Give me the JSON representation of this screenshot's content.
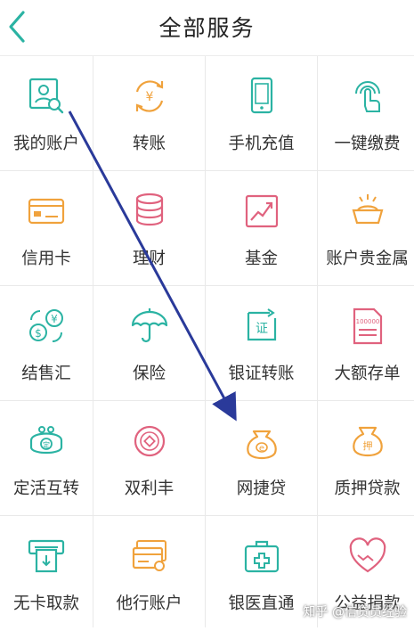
{
  "header": {
    "title": "全部服务"
  },
  "services": [
    {
      "label": "我的账户",
      "icon": "account-icon"
    },
    {
      "label": "转账",
      "icon": "transfer-icon"
    },
    {
      "label": "手机充值",
      "icon": "phone-recharge-icon"
    },
    {
      "label": "一键缴费",
      "icon": "one-tap-pay-icon"
    },
    {
      "label": "信用卡",
      "icon": "credit-card-icon"
    },
    {
      "label": "理财",
      "icon": "coins-stack-icon"
    },
    {
      "label": "基金",
      "icon": "fund-chart-icon"
    },
    {
      "label": "账户贵金属",
      "icon": "gold-bar-icon"
    },
    {
      "label": "结售汇",
      "icon": "currency-exchange-icon"
    },
    {
      "label": "保险",
      "icon": "umbrella-icon"
    },
    {
      "label": "银证转账",
      "icon": "securities-icon"
    },
    {
      "label": "大额存单",
      "icon": "deposit-certificate-icon"
    },
    {
      "label": "定活互转",
      "icon": "purse-icon"
    },
    {
      "label": "双利丰",
      "icon": "coin-icon"
    },
    {
      "label": "网捷贷",
      "icon": "loan-bag-icon"
    },
    {
      "label": "质押贷款",
      "icon": "pledge-bag-icon"
    },
    {
      "label": "无卡取款",
      "icon": "atm-icon"
    },
    {
      "label": "他行账户",
      "icon": "other-bank-cards-icon"
    },
    {
      "label": "银医直通",
      "icon": "medical-kit-icon"
    },
    {
      "label": "公益捐款",
      "icon": "charity-heart-icon"
    }
  ],
  "watermark": "知乎 @信贷员经验",
  "colors": {
    "green": "#2bb3a3",
    "orange": "#f0a23c",
    "pink": "#e0627e",
    "arrow": "#2a3a9a"
  }
}
